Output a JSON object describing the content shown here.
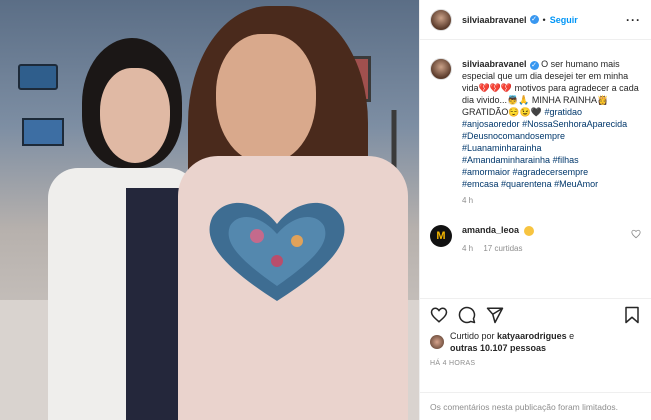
{
  "post": {
    "username": "silviaabravanel",
    "follow_label": "Seguir",
    "caption_text": "O ser humano mais especial que um dia desejei ter em minha vida💔💔💔 motivos para agradecer a cada dia vivido...👼🙏 MINHA RAINHA👸 GRATIDÃO😌😉🖤",
    "hashtags": [
      "#gratidao",
      "#anjosaoredor",
      "#NossaSenhoraAparecida",
      "#Deusnocomandosempre",
      "#Luanaminharainha",
      "#Amandaminharainha",
      "#filhas",
      "#amormaior",
      "#agradecersempre",
      "#emcasa",
      "#quarentena",
      "#MeuAmor"
    ],
    "caption_time": "4 h"
  },
  "comment": {
    "username": "amanda_leoa",
    "avatar_letter": "M",
    "time": "4 h",
    "likes": "17 curtidas"
  },
  "likes_summary": {
    "prefix": "Curtido por",
    "user": "katyaarodrigues",
    "connector": "e",
    "others": "outras 10.107 pessoas"
  },
  "posted_ago": "HÁ 4 HORAS",
  "footer_notice": "Os comentários nesta publicação foram limitados.",
  "icons": [
    "heart-icon",
    "comment-icon",
    "share-icon",
    "bookmark-icon",
    "more-icon",
    "verified-icon"
  ],
  "colors": {
    "link": "#00376b",
    "follow": "#0095f6",
    "verified": "#3897f0",
    "muted": "#8e8e8e"
  }
}
